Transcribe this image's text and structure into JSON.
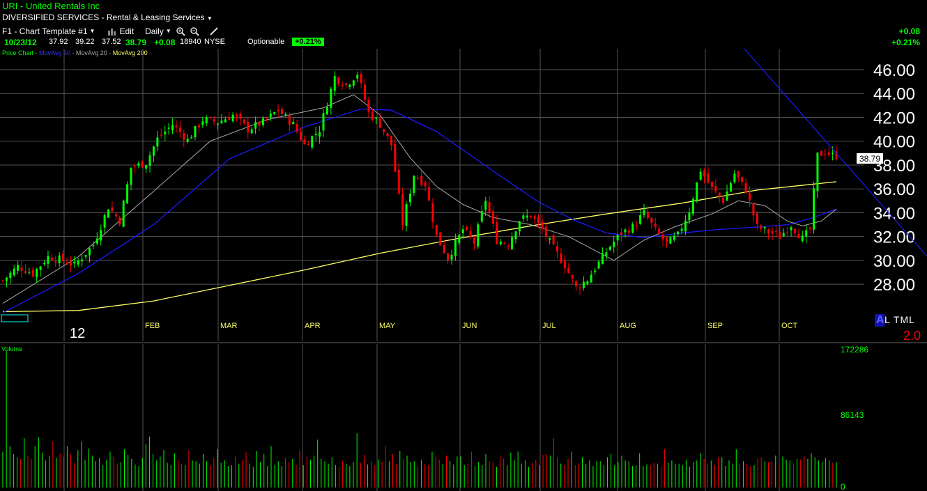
{
  "header": {
    "symbol": "URI",
    "company": "United Rentals Inc",
    "sector": "DIVERSIFIED SERVICES - Rental & Leasing Services",
    "template_label": "F1 - Chart Template #1",
    "edit_label": "Edit",
    "period_label": "Daily",
    "date": "10/23/12",
    "open": "37.92",
    "high": "39.22",
    "low": "37.52",
    "last": "38.79",
    "change": "+0.08",
    "volume": "18940",
    "exchange": "NYSE",
    "optionable_label": "Optionable",
    "pct_change": "+0.21%",
    "right_change": "+0.08",
    "right_pct": "+0.21%"
  },
  "legend": {
    "price_chart": "Price Chart",
    "ma50": "MovAvg 50",
    "ma20": "MovAvg 20",
    "ma200": "MovAvg 200"
  },
  "badges": {
    "alert_a": "A",
    "alert_rest": "L TML",
    "ratio": "2.0",
    "year": "12",
    "last_price_tag": "38.79"
  },
  "colors": {
    "background": "#000000",
    "up": "#00ff00",
    "down": "#ff0000",
    "ma50": "#1a1aff",
    "ma20": "#aaaaaa",
    "ma200": "#ffff66",
    "month_label": "#ffff66"
  },
  "chart_data": {
    "type": "candlestick",
    "title": "URI - United Rentals Inc",
    "y_ticks": [
      "46.00",
      "44.00",
      "42.00",
      "40.00",
      "38.00",
      "36.00",
      "34.00",
      "32.00",
      "30.00",
      "28.00"
    ],
    "ylim": [
      25.5,
      47.5
    ],
    "months": [
      "FEB",
      "MAR",
      "APR",
      "MAY",
      "JUN",
      "JUL",
      "AUG",
      "SEP",
      "OCT"
    ],
    "price_path": [
      [
        0,
        28.3
      ],
      [
        4,
        29.5
      ],
      [
        8,
        28.9
      ],
      [
        12,
        30.3
      ],
      [
        15,
        30.1
      ],
      [
        19,
        29.6
      ],
      [
        24,
        31.3
      ],
      [
        28,
        34.5
      ],
      [
        31,
        33.3
      ],
      [
        34,
        37.8
      ],
      [
        38,
        38.2
      ],
      [
        41,
        40.2
      ],
      [
        45,
        41.4
      ],
      [
        49,
        40.1
      ],
      [
        53,
        41.8
      ],
      [
        57,
        41.6
      ],
      [
        61,
        42.2
      ],
      [
        65,
        41.0
      ],
      [
        69,
        41.6
      ],
      [
        73,
        42.6
      ],
      [
        77,
        41.4
      ],
      [
        80,
        39.7
      ],
      [
        84,
        41.0
      ],
      [
        88,
        45.4
      ],
      [
        91,
        44.7
      ],
      [
        94,
        45.7
      ],
      [
        97,
        42.4
      ],
      [
        100,
        41.4
      ],
      [
        103,
        39.7
      ],
      [
        106,
        33.1
      ],
      [
        109,
        37.2
      ],
      [
        112,
        36.4
      ],
      [
        115,
        32.0
      ],
      [
        118,
        30.2
      ],
      [
        122,
        32.6
      ],
      [
        125,
        31.5
      ],
      [
        128,
        35.1
      ],
      [
        131,
        31.7
      ],
      [
        134,
        31.4
      ],
      [
        137,
        33.4
      ],
      [
        140,
        33.8
      ],
      [
        143,
        32.6
      ],
      [
        146,
        31.0
      ],
      [
        149,
        29.6
      ],
      [
        152,
        27.7
      ],
      [
        155,
        28.4
      ],
      [
        158,
        29.8
      ],
      [
        161,
        31.2
      ],
      [
        164,
        32.3
      ],
      [
        167,
        32.8
      ],
      [
        170,
        34.0
      ],
      [
        173,
        32.5
      ],
      [
        176,
        31.4
      ],
      [
        179,
        32.1
      ],
      [
        182,
        34.2
      ],
      [
        185,
        37.6
      ],
      [
        188,
        36.0
      ],
      [
        191,
        35.0
      ],
      [
        194,
        37.3
      ],
      [
        197,
        35.9
      ],
      [
        200,
        32.8
      ],
      [
        203,
        32.4
      ],
      [
        206,
        32.0
      ],
      [
        209,
        33.0
      ],
      [
        212,
        31.8
      ],
      [
        214,
        32.6
      ],
      [
        216,
        38.8
      ],
      [
        218,
        39.1
      ],
      [
        220,
        38.79
      ]
    ],
    "ma20": [
      [
        0,
        26.4
      ],
      [
        20,
        30.3
      ],
      [
        40,
        35.8
      ],
      [
        55,
        40.0
      ],
      [
        70,
        41.8
      ],
      [
        85,
        42.8
      ],
      [
        93,
        43.9
      ],
      [
        100,
        42.2
      ],
      [
        108,
        38.6
      ],
      [
        115,
        36.2
      ],
      [
        122,
        34.7
      ],
      [
        130,
        33.6
      ],
      [
        140,
        33.0
      ],
      [
        150,
        32.0
      ],
      [
        162,
        30.0
      ],
      [
        170,
        31.7
      ],
      [
        178,
        32.8
      ],
      [
        188,
        33.9
      ],
      [
        195,
        35.0
      ],
      [
        202,
        34.6
      ],
      [
        208,
        33.3
      ],
      [
        212,
        32.9
      ],
      [
        217,
        33.3
      ],
      [
        221,
        34.3
      ]
    ],
    "ma50": [
      [
        0,
        25.6
      ],
      [
        20,
        28.9
      ],
      [
        40,
        33.0
      ],
      [
        60,
        38.5
      ],
      [
        80,
        41.2
      ],
      [
        95,
        42.7
      ],
      [
        103,
        42.6
      ],
      [
        115,
        40.8
      ],
      [
        130,
        37.5
      ],
      [
        142,
        34.9
      ],
      [
        152,
        33.3
      ],
      [
        160,
        32.3
      ],
      [
        170,
        31.9
      ],
      [
        180,
        32.3
      ],
      [
        190,
        32.6
      ],
      [
        200,
        32.8
      ],
      [
        208,
        33.0
      ],
      [
        214,
        33.5
      ],
      [
        221,
        34.3
      ]
    ],
    "ma200": [
      [
        0,
        25.7
      ],
      [
        20,
        25.8
      ],
      [
        40,
        26.6
      ],
      [
        60,
        27.9
      ],
      [
        80,
        29.2
      ],
      [
        100,
        30.6
      ],
      [
        120,
        31.8
      ],
      [
        140,
        32.9
      ],
      [
        160,
        33.9
      ],
      [
        180,
        34.8
      ],
      [
        200,
        35.9
      ],
      [
        221,
        36.6
      ]
    ],
    "volume": {
      "ylim": [
        0,
        172286
      ],
      "tick_labels": [
        "172286",
        "86143",
        "0"
      ],
      "values": [
        45000,
        172286,
        52000,
        42000,
        38000,
        36000,
        62000,
        40000,
        36000,
        52000,
        63000,
        44000,
        34000,
        40000,
        58000,
        37000,
        43000,
        39000,
        52000,
        42000,
        31000,
        47000,
        58000,
        35000,
        49000,
        40000,
        33000,
        37000,
        28000,
        35000,
        45000,
        39000,
        30000,
        32000,
        48000,
        41000,
        36000,
        29000,
        27000,
        37000,
        55000,
        64000,
        42000,
        34000,
        39000,
        47000,
        31000,
        28000,
        43000,
        35000,
        30000,
        28000,
        47000,
        34000,
        33000,
        30000,
        42000,
        33000,
        28000,
        37000,
        48000,
        31000,
        34000,
        27000,
        28000,
        39000,
        30000,
        35000,
        44000,
        30000,
        26000,
        46000,
        32000,
        42000,
        27000,
        52000,
        28000,
        33000,
        27000,
        37000,
        32000,
        36000,
        28000,
        47000,
        28000,
        39000,
        35000,
        40000,
        60000,
        36000,
        33000,
        30000,
        38000,
        28000,
        26000,
        33000,
        30000,
        27000,
        32000,
        68000,
        31000,
        41000,
        29000,
        33000,
        28000,
        35000,
        32000,
        52000,
        33000,
        42000,
        29000,
        46000,
        36000,
        40000,
        32000,
        33000,
        26000,
        35000,
        30000,
        28000,
        45000,
        39000,
        35000,
        30000,
        40000,
        33000,
        29000,
        39000,
        39000,
        28000,
        30000,
        45000,
        27000,
        32000,
        28000,
        42000,
        33000,
        31000,
        26000,
        39000,
        36000,
        28000,
        44000,
        34000,
        45000,
        30000,
        34000,
        26000,
        31000,
        35000,
        28000,
        41000,
        42000,
        40000,
        62000,
        38000,
        30000,
        28000,
        36000,
        45000,
        28000,
        30000,
        38000,
        30000,
        34000,
        27000,
        33000,
        33000,
        28000,
        38000,
        42000,
        28000,
        32000,
        40000,
        34000,
        33000,
        27000,
        28000,
        43000,
        27000,
        29000,
        28000,
        31000,
        30000,
        26000,
        48000,
        31000,
        34000,
        30000,
        30000,
        28000,
        35000,
        26000,
        32000,
        34000,
        43000,
        36000,
        30000,
        34000,
        28000,
        38000,
        38000,
        27000,
        34000,
        30000,
        48000,
        30000,
        33000,
        30000,
        27000,
        28000,
        36000,
        38000,
        33000,
        32000,
        33000,
        40000,
        30000,
        39000,
        35000,
        34000,
        30000,
        36000,
        35000,
        40000,
        36000,
        43000,
        38000,
        34000,
        32000,
        37000,
        34000,
        31000,
        32000
      ]
    }
  }
}
